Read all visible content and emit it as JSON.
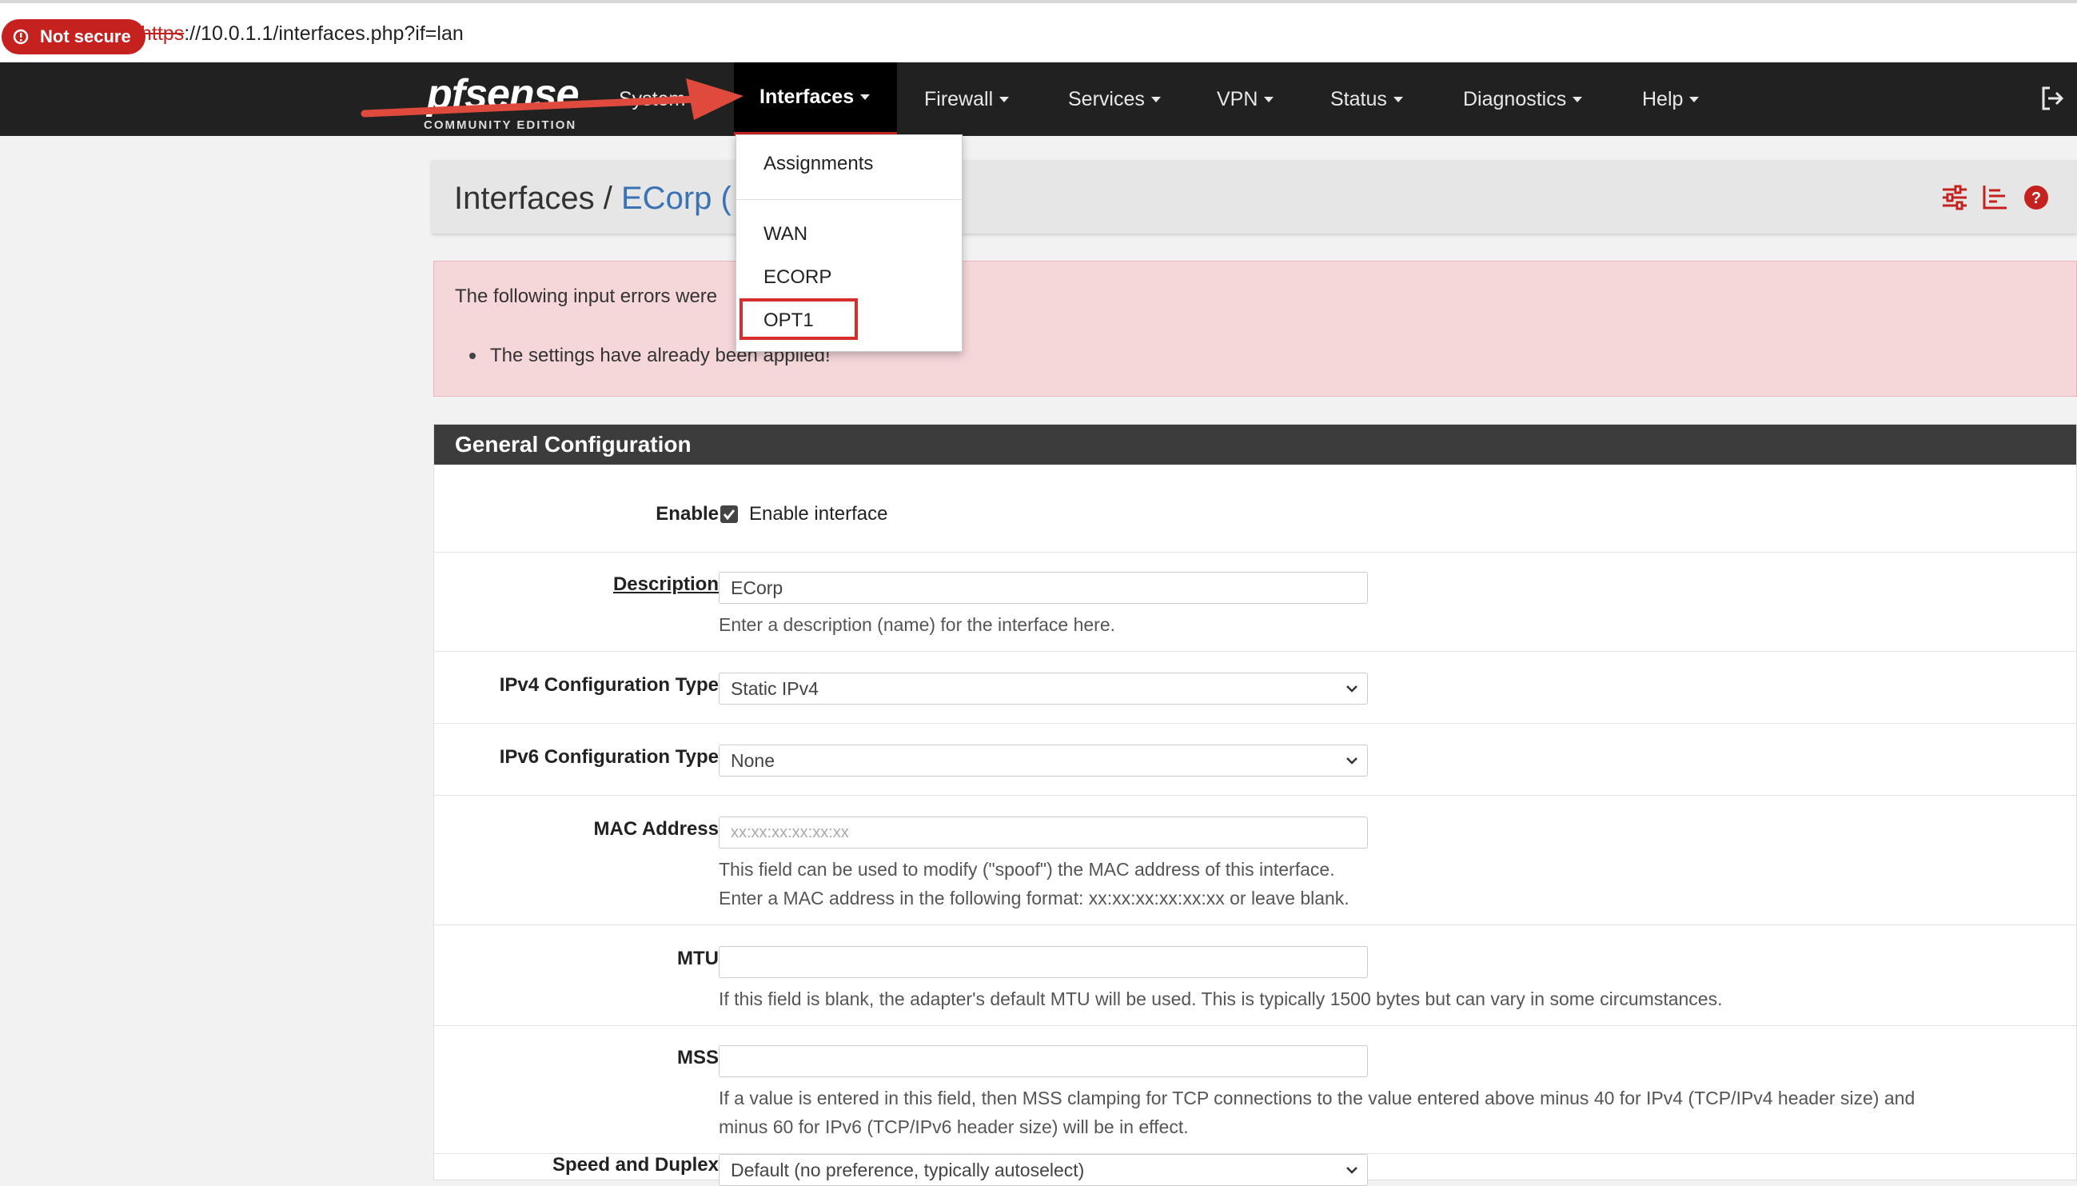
{
  "browser": {
    "security_badge": "Not secure",
    "url_scheme": "https",
    "url_rest": "://10.0.1.1/interfaces.php?if=lan"
  },
  "navbar": {
    "logo_text": "pfsense",
    "logo_sub": "COMMUNITY EDITION",
    "items": [
      {
        "label": "System"
      },
      {
        "label": "Interfaces"
      },
      {
        "label": "Firewall"
      },
      {
        "label": "Services"
      },
      {
        "label": "VPN"
      },
      {
        "label": "Status"
      },
      {
        "label": "Diagnostics"
      },
      {
        "label": "Help"
      }
    ],
    "active_item": "Interfaces"
  },
  "dropdown": {
    "items": [
      {
        "label": "Assignments"
      },
      {
        "label": "WAN"
      },
      {
        "label": "ECORP"
      },
      {
        "label": "OPT1"
      }
    ],
    "highlighted": "OPT1"
  },
  "page_header": {
    "crumb_root": "Interfaces /",
    "crumb_current": "ECorp ("
  },
  "errors": {
    "title": "The following input errors were",
    "items": [
      "The settings have already been applied!"
    ]
  },
  "general_config": {
    "heading": "General Configuration",
    "enable": {
      "label": "Enable",
      "checkbox_label": "Enable interface",
      "checked": true
    },
    "description": {
      "label": "Description",
      "value": "ECorp",
      "help": "Enter a description (name) for the interface here."
    },
    "ipv4_type": {
      "label": "IPv4 Configuration Type",
      "value": "Static IPv4"
    },
    "ipv6_type": {
      "label": "IPv6 Configuration Type",
      "value": "None"
    },
    "mac": {
      "label": "MAC Address",
      "placeholder": "xx:xx:xx:xx:xx:xx",
      "help1": "This field can be used to modify (\"spoof\") the MAC address of this interface.",
      "help2": "Enter a MAC address in the following format: xx:xx:xx:xx:xx:xx or leave blank."
    },
    "mtu": {
      "label": "MTU",
      "value": "",
      "help": "If this field is blank, the adapter's default MTU will be used. This is typically 1500 bytes but can vary in some circumstances."
    },
    "mss": {
      "label": "MSS",
      "value": "",
      "help1": "If a value is entered in this field, then MSS clamping for TCP connections to the value entered above minus 40 for IPv4 (TCP/IPv4 header size) and",
      "help2": "minus 60 for IPv6 (TCP/IPv6 header size) will be in effect."
    },
    "speed": {
      "label": "Speed and Duplex",
      "value": "Default (no preference, typically autoselect)"
    }
  },
  "colors": {
    "navbar_bg": "#212121",
    "active_underline": "#c5221f",
    "link_blue": "#3a73b4",
    "error_bg": "#f5d6d9",
    "panel_head_bg": "#3c3c3c",
    "annotation_red": "#d62e2e"
  }
}
